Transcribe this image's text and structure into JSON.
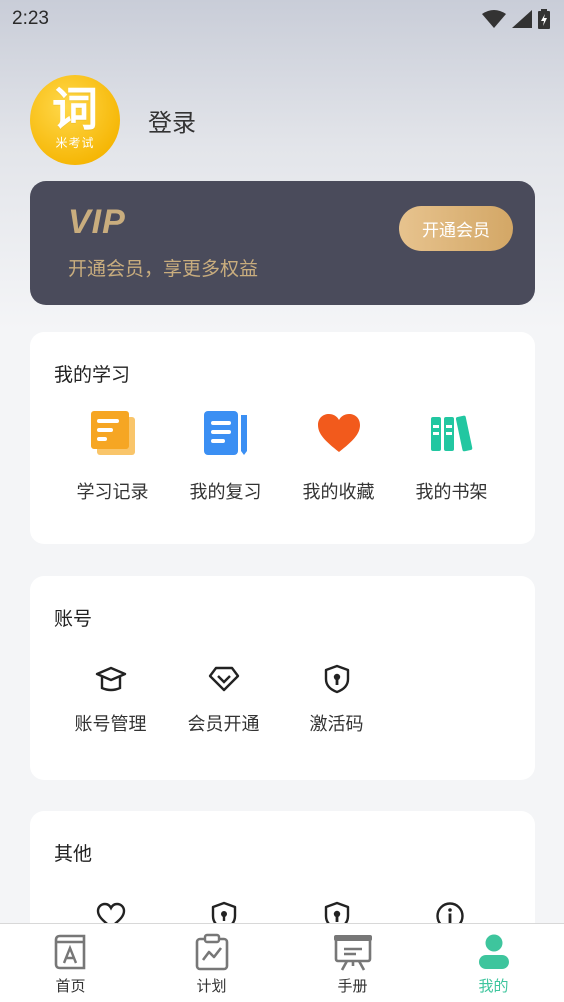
{
  "status_bar": {
    "time": "2:23"
  },
  "profile": {
    "logo_main": "词",
    "logo_sub": "米考试",
    "login_label": "登录"
  },
  "vip": {
    "logo_text": "VIP",
    "description": "开通会员，享更多权益",
    "button_label": "开通会员"
  },
  "study": {
    "title": "我的学习",
    "items": [
      {
        "label": "学习记录",
        "icon": "study-record-icon",
        "color": "#f6a623"
      },
      {
        "label": "我的复习",
        "icon": "review-icon",
        "color": "#3b8ff3"
      },
      {
        "label": "我的收藏",
        "icon": "heart-icon",
        "color": "#f25a1c"
      },
      {
        "label": "我的书架",
        "icon": "bookshelf-icon",
        "color": "#22c7a1"
      }
    ]
  },
  "account": {
    "title": "账号",
    "items": [
      {
        "label": "账号管理",
        "icon": "graduation-cap-icon"
      },
      {
        "label": "会员开通",
        "icon": "diamond-icon"
      },
      {
        "label": "激活码",
        "icon": "shield-key-icon"
      }
    ]
  },
  "other": {
    "title": "其他",
    "items": [
      {
        "icon": "heart-outline-icon"
      },
      {
        "icon": "shield-lock-icon"
      },
      {
        "icon": "shield-key-icon"
      },
      {
        "icon": "info-icon"
      }
    ]
  },
  "tabs": [
    {
      "label": "首页",
      "icon": "home-book-icon",
      "active": false
    },
    {
      "label": "计划",
      "icon": "plan-chart-icon",
      "active": false
    },
    {
      "label": "手册",
      "icon": "manual-board-icon",
      "active": false
    },
    {
      "label": "我的",
      "icon": "person-icon",
      "active": true
    }
  ],
  "colors": {
    "accent": "#3ec59d",
    "vip_gold": "#c9ad7e",
    "vip_bg": "#4a4b5b"
  }
}
